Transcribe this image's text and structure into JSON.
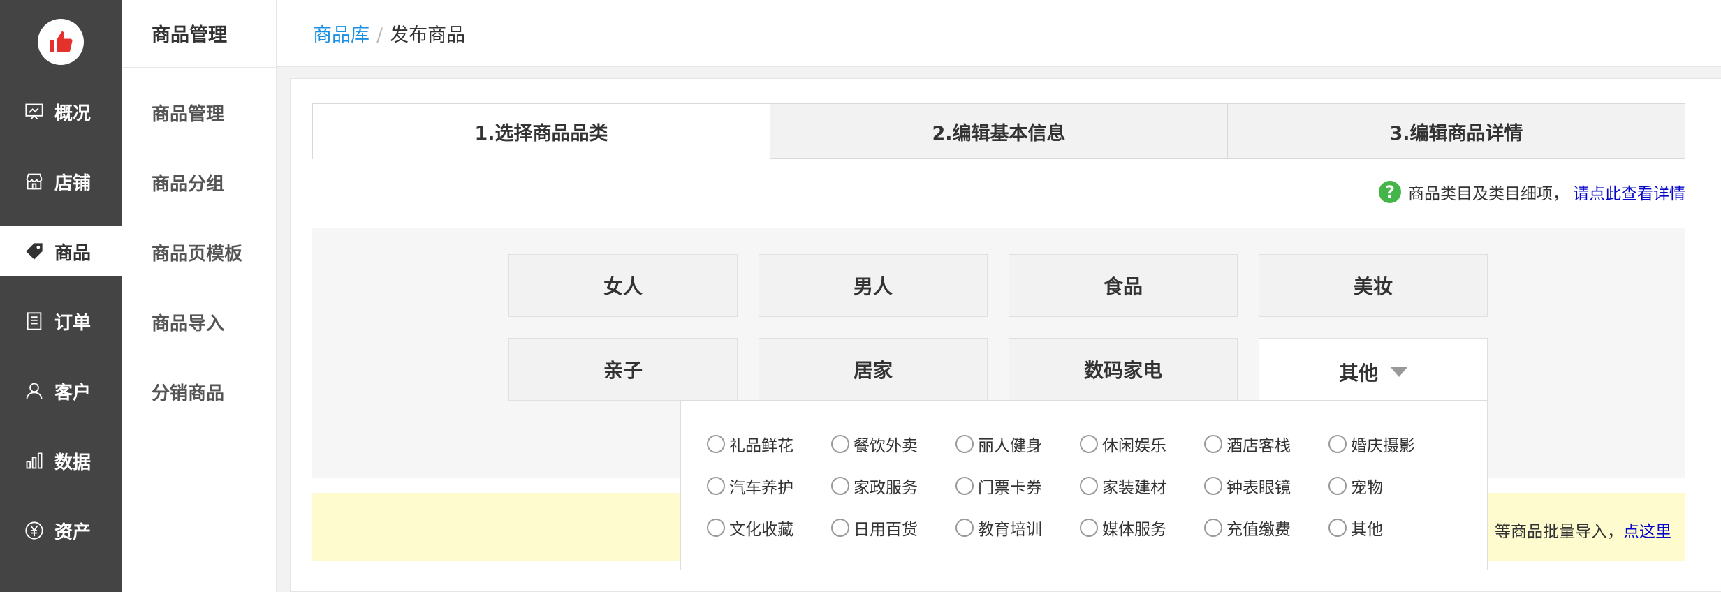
{
  "sidebar": {
    "items": [
      {
        "label": "概况",
        "icon": "overview-icon"
      },
      {
        "label": "店铺",
        "icon": "store-icon"
      },
      {
        "label": "商品",
        "icon": "tag-icon",
        "active": true
      },
      {
        "label": "订单",
        "icon": "order-icon"
      },
      {
        "label": "客户",
        "icon": "user-icon"
      },
      {
        "label": "数据",
        "icon": "chart-icon"
      },
      {
        "label": "资产",
        "icon": "yen-icon"
      }
    ]
  },
  "subnav": {
    "title": "商品管理",
    "items": [
      "商品管理",
      "商品分组",
      "商品页模板",
      "商品导入",
      "分销商品"
    ]
  },
  "breadcrumb": {
    "parent": "商品库",
    "separator": "/",
    "current": "发布商品"
  },
  "steps": [
    "1.选择商品品类",
    "2.编辑基本信息",
    "3.编辑商品详情"
  ],
  "help": {
    "text": "商品类目及类目细项，",
    "link": "请点此查看详情"
  },
  "categories": {
    "row1": [
      "女人",
      "男人",
      "食品",
      "美妆"
    ],
    "row2": [
      "亲子",
      "居家",
      "数码家电",
      "其他"
    ]
  },
  "dropdown_options": [
    [
      "礼品鲜花",
      "餐饮外卖",
      "丽人健身",
      "休闲娱乐",
      "酒店客栈",
      "婚庆摄影"
    ],
    [
      "汽车养护",
      "家政服务",
      "门票卡券",
      "家装建材",
      "钟表眼镜",
      "宠物"
    ],
    [
      "文化收藏",
      "日用百货",
      "教育培训",
      "媒体服务",
      "充值缴费",
      "其他"
    ]
  ],
  "notice": {
    "text": "等商品批量导入，",
    "link": "点这里"
  },
  "colors": {
    "sidebar_bg": "#444444",
    "link_blue": "#1a8fe3",
    "help_green": "#44b549",
    "notice_bg": "#fefccf"
  }
}
